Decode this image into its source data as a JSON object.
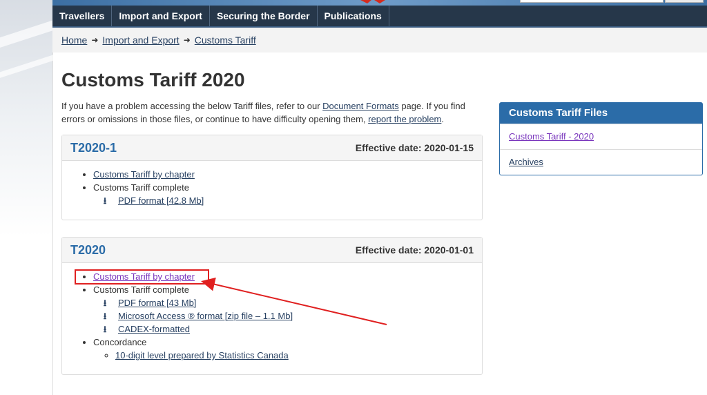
{
  "nav": {
    "items": [
      "Travellers",
      "Import and Export",
      "Securing the Border",
      "Publications"
    ]
  },
  "breadcrumb": {
    "items": [
      "Home",
      "Import and Export",
      "Customs Tariff"
    ]
  },
  "page": {
    "title": "Customs Tariff 2020",
    "intro_part1": "If you have a problem accessing the below Tariff files, refer to our ",
    "intro_link1": "Document Formats",
    "intro_part2": " page. If you find errors or omissions in those files, or continue to have difficulty opening them, ",
    "intro_link2": "report the problem",
    "intro_part3": "."
  },
  "panels": [
    {
      "title": "T2020-1",
      "date": "Effective date: 2020-01-15",
      "by_chapter": "Customs Tariff by chapter",
      "complete_label": "Customs Tariff complete",
      "downloads": [
        "PDF format [42.8 Mb]"
      ]
    },
    {
      "title": "T2020",
      "date": "Effective date: 2020-01-01",
      "by_chapter": "Customs Tariff by chapter",
      "complete_label": "Customs Tariff complete",
      "downloads": [
        "PDF format [43 Mb]",
        "Microsoft Access ® format [zip file – 1.1 Mb]",
        "CADEX-formatted"
      ],
      "concordance_label": "Concordance",
      "concordance_items": [
        "10-digit level prepared by Statistics Canada"
      ]
    }
  ],
  "sidebar": {
    "title": "Customs Tariff Files",
    "items": [
      "Customs Tariff - 2020",
      "Archives"
    ]
  },
  "colors": {
    "nav_bg": "#26374a",
    "panel_title": "#2b6ca8",
    "link": "#284162",
    "visited_link": "#7834bc",
    "annotation": "#e02020"
  },
  "icons": {
    "download": "download-icon"
  }
}
